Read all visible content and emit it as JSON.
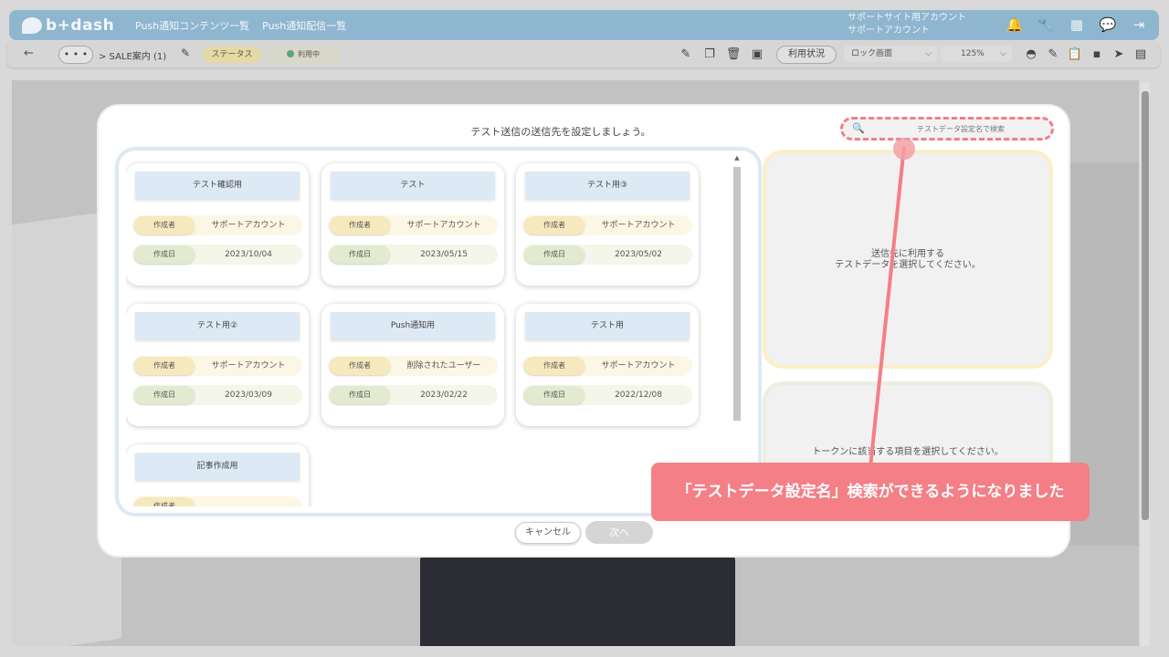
{
  "header": {
    "logo_text": "b+dash",
    "nav": [
      "Push通知コンテンツ一覧",
      "Push通知配信一覧"
    ],
    "account_line1": "サポートサイト用アカウント",
    "account_line2": "サポートアカウント",
    "icons": [
      "bell-icon",
      "wrench-icon",
      "grid-icon",
      "chat-icon",
      "logout-icon"
    ]
  },
  "toolbar": {
    "back": "←",
    "more": "• • •",
    "breadcrumb": "> SALE案内 (1)",
    "status_label": "ステータス",
    "status_value": "利用中",
    "usage_button": "利用状況",
    "screen_select": "ロック画面",
    "zoom_select": "125%"
  },
  "modal": {
    "title": "テスト送信の送信先を設定しましょう。",
    "search_placeholder": "テストデータ設定名で検索",
    "author_label": "作成者",
    "date_label": "作成日",
    "cards": [
      {
        "title": "テスト確認用",
        "author": "サポートアカウント",
        "date": "2023/10/04"
      },
      {
        "title": "テスト",
        "author": "サポートアカウント",
        "date": "2023/05/15"
      },
      {
        "title": "テスト用③",
        "author": "サポートアカウント",
        "date": "2023/05/02"
      },
      {
        "title": "テスト用②",
        "author": "サポートアカウント",
        "date": "2023/03/09"
      },
      {
        "title": "Push通知用",
        "author": "削除されたユーザー",
        "date": "2023/02/22"
      },
      {
        "title": "テスト用",
        "author": "サポートアカウント",
        "date": "2022/12/08"
      },
      {
        "title": "記事作成用",
        "author": "",
        "date": ""
      }
    ],
    "preview_top_line1": "送信先に利用する",
    "preview_top_line2": "テストデータを選択してください。",
    "preview_bottom": "トークンに該当する項目を選択してください。",
    "cancel_label": "キャンセル",
    "next_label": "次へ"
  },
  "annotation": {
    "text": "「テストデータ設定名」検索ができるようになりました",
    "color": "#f47f86"
  }
}
